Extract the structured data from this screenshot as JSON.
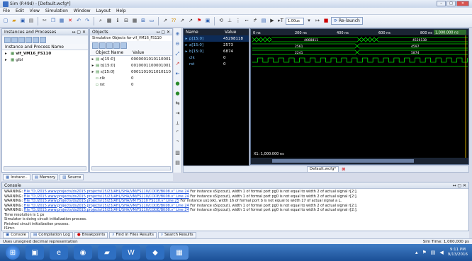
{
  "window": {
    "title": "Sim (P.49d) - [Default.wcfg*]"
  },
  "menu": [
    "File",
    "Edit",
    "View",
    "Simulation",
    "Window",
    "Layout",
    "Help"
  ],
  "toolbar": {
    "run_time": "1.00us",
    "relaunch": "Re-launch"
  },
  "instances_panel": {
    "title": "Instances and Processes",
    "col": "Instance and Process Name",
    "items": [
      "vlf_VM16_FS110",
      "glbl"
    ]
  },
  "objects_panel": {
    "title": "Objects",
    "subtitle": "Simulation Objects for vlf_VM16_FS110",
    "col_name": "Object Name",
    "col_value": "Value",
    "rows": [
      {
        "name": "a[15:0]",
        "value": "0000001010110001"
      },
      {
        "name": "b[15:0]",
        "value": "0010001100001001"
      },
      {
        "name": "s[15:0]",
        "value": "0001101011010110"
      },
      {
        "name": "clk",
        "value": "0"
      },
      {
        "name": "rst",
        "value": "0"
      }
    ]
  },
  "wave": {
    "col_name": "Name",
    "col_value": "Value",
    "signals": [
      {
        "name": "p[15:0]",
        "value": "45298118"
      },
      {
        "name": "a[15:0]",
        "value": "2573"
      },
      {
        "name": "b[15:0]",
        "value": "6874"
      },
      {
        "name": "clk",
        "value": "0"
      },
      {
        "name": "rst",
        "value": "0"
      }
    ],
    "time_labels": [
      "0 ns",
      "200 ns",
      "400 ns",
      "600 ns",
      "800 ns"
    ],
    "cursor_time": "1,000.000 ns",
    "bus_values": {
      "p": [
        "4668811",
        "4526138"
      ],
      "a": [
        "2561",
        "4597"
      ],
      "b": [
        "2241",
        "5874"
      ]
    },
    "x_readout": "X1: 1,000.000 ns"
  },
  "tabs_left": [
    "Instanc..",
    "Memory",
    "Source"
  ],
  "wave_tab": "Default.wcfg*",
  "console": {
    "title": "Console",
    "lines": [
      {
        "pre": "WARNING: ",
        "link": "File \"D:/2015.www.projects/ds2015.projects/15/23/AHL/SHA/VM/FS110/CODE/BK08.v\" Line 24",
        "post": "  For instance s5(pcout), width 1 of formal port pg0 is not equal to width 2 of actual signal r[2:].",
        "href": true
      },
      {
        "pre": "WARNING: ",
        "link": "File \"D:/2015.www.projects/ds2015.projects/15/23/AHL/SHA/VM/FS110/CODE/BK08.v\" Line 24",
        "post": "  For instance s5(pcout), width 1 of formal port pg0 is not equal to width 2 of actual signal r[2:].",
        "href": true
      },
      {
        "pre": "WARNING: ",
        "link": "File \"D:/2015.www.projects/ds2015.projects/15/23/AHL/SHA/VM FS110 FS110.v\" Line 25",
        "post": "  For instance us1(xk), width 16 of formal port b is not equal to width 17 of actual signal a L.",
        "href": true
      },
      {
        "pre": "WARNING: ",
        "link": "File \"D:/2015.www.projects/ds2015.projects/15/23/AHL/SHA/VM/FS110/CODE/BK08.v\" Line 24",
        "post": "  For instance s5(pcout), width 1 of formal port pg0 is not equal to width 2 of actual signal r[2:].",
        "href": true
      },
      {
        "pre": "WARNING: ",
        "link": "File \"D:/2015.www.projects/ds2015.projects/15/23/AHL/SHA/VM/FS110/CODE/BK08.v\" Line 24",
        "post": "  For instance s5(pcout), width 1 of formal port pg0 is not equal to width 2 of actual signal r[2:].",
        "href": true
      },
      {
        "pre": "Time resolution is 1 ps",
        "link": "",
        "post": "",
        "href": false
      },
      {
        "pre": "Simulator is doing circuit initialization process.",
        "link": "",
        "post": "",
        "href": false
      },
      {
        "pre": "Finished circuit initialization process.",
        "link": "",
        "post": "",
        "href": false
      },
      {
        "pre": "ISim>",
        "link": "",
        "post": "",
        "href": false
      }
    ]
  },
  "bottom_tabs": [
    "Console",
    "Compilation Log",
    "Breakpoints",
    "Find in Files Results",
    "Search Results"
  ],
  "status": {
    "left": "Uses unsigned decimal representation",
    "right": "Sim Time: 1,000,000 ps"
  },
  "clock": {
    "time": "9:11 PM",
    "date": "9/13/2016"
  },
  "colors": {
    "wave_green": "#00e000",
    "wave_bg": "#000000",
    "signal_name": "#7cc4ff",
    "taskbar": "#1b4f96"
  }
}
